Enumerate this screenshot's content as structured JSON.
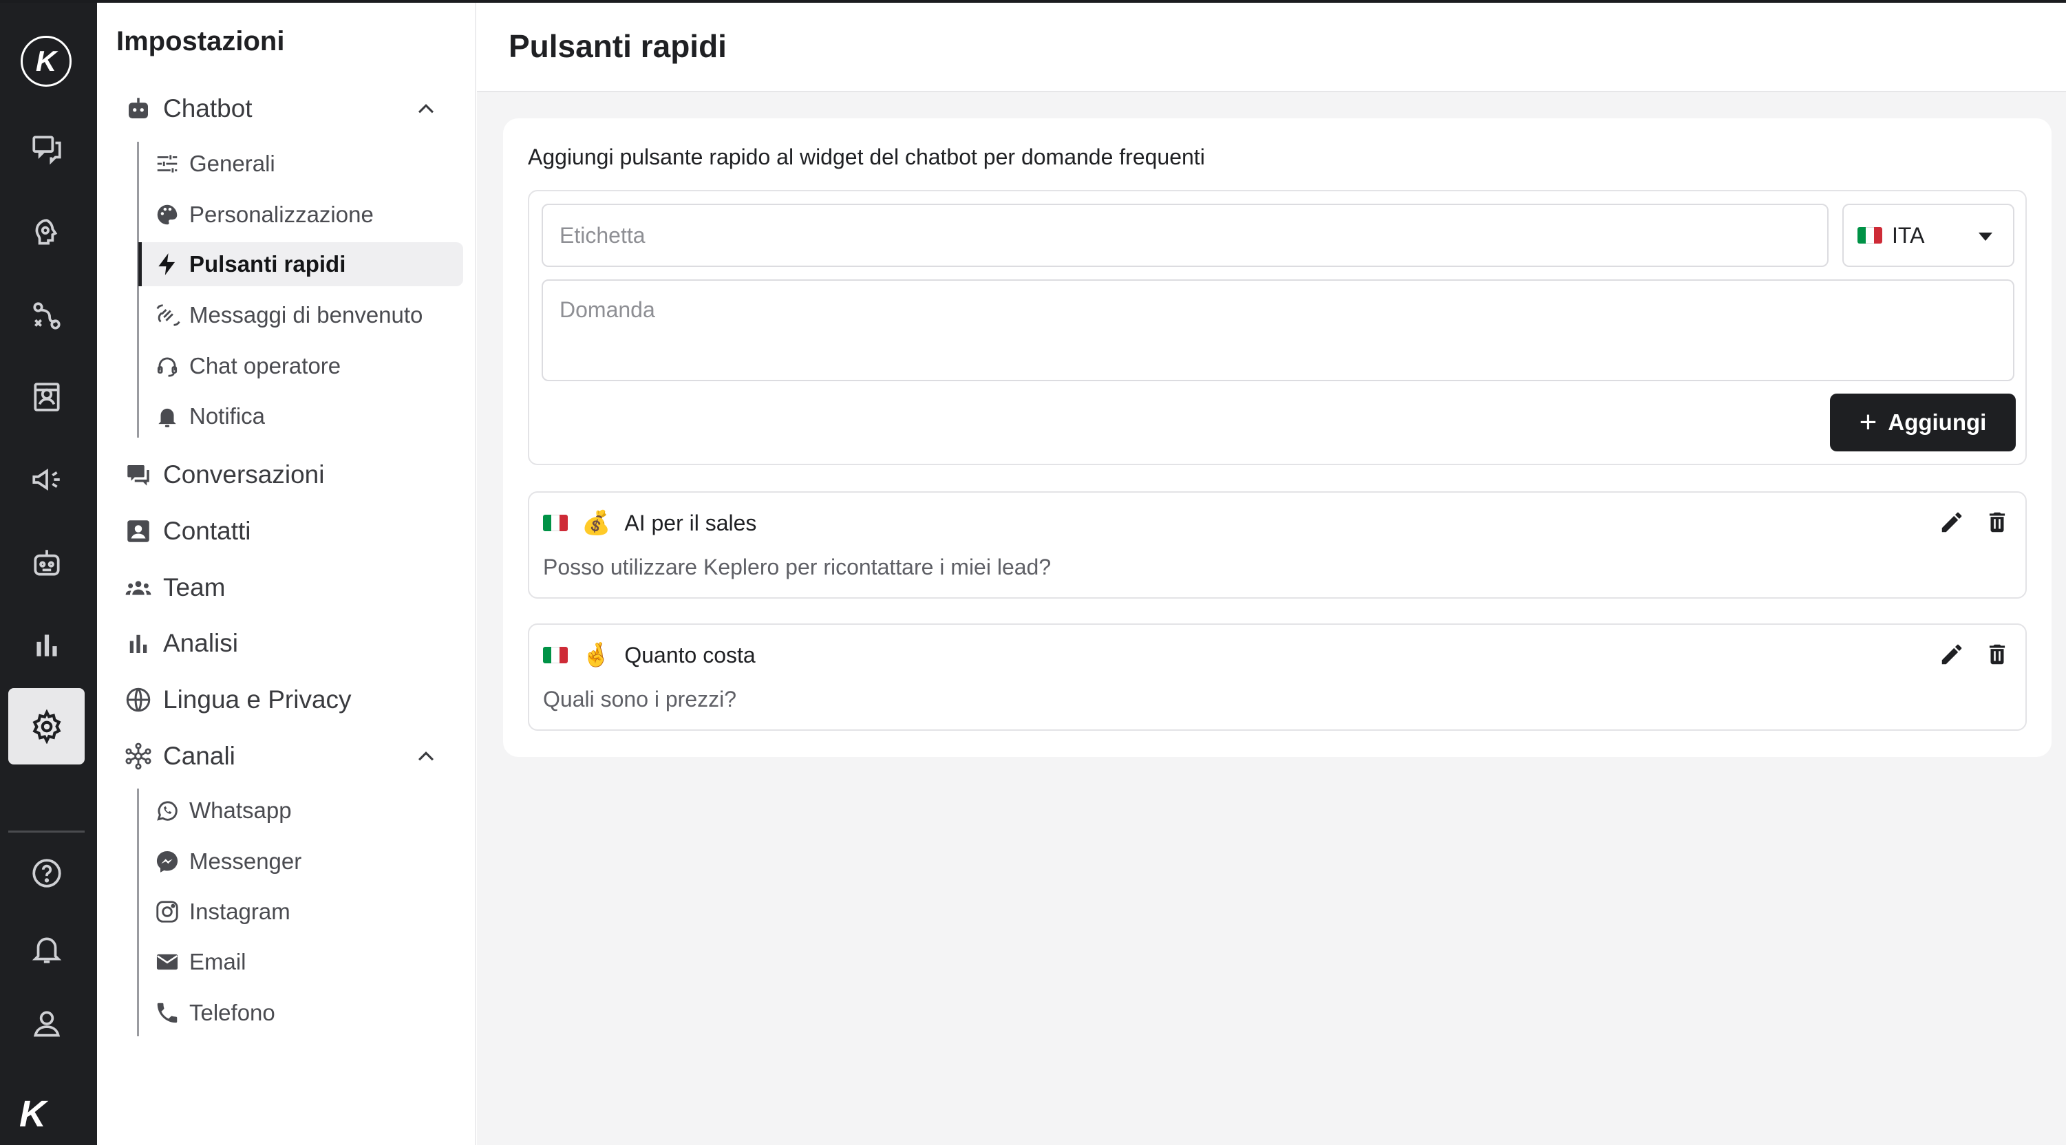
{
  "app": {
    "logo_letter": "K"
  },
  "rail": {
    "items": [
      {
        "name": "conversations-icon"
      },
      {
        "name": "knowledge-icon"
      },
      {
        "name": "flows-icon"
      },
      {
        "name": "contacts-icon"
      },
      {
        "name": "campaigns-icon"
      },
      {
        "name": "bot-icon"
      },
      {
        "name": "analytics-icon"
      },
      {
        "name": "settings-icon",
        "active": true
      }
    ],
    "bottom": [
      {
        "name": "help-icon"
      },
      {
        "name": "notifications-icon"
      },
      {
        "name": "profile-icon"
      }
    ]
  },
  "sidebar": {
    "title": "Impostazioni",
    "chatbot": {
      "label": "Chatbot",
      "items": [
        {
          "label": "Generali",
          "icon": "sliders-icon"
        },
        {
          "label": "Personalizzazione",
          "icon": "palette-icon"
        },
        {
          "label": "Pulsanti rapidi",
          "icon": "bolt-icon",
          "active": true
        },
        {
          "label": "Messaggi di benvenuto",
          "icon": "wave-icon"
        },
        {
          "label": "Chat operatore",
          "icon": "headset-icon"
        },
        {
          "label": "Notifica",
          "icon": "bell-icon"
        }
      ]
    },
    "sections": [
      {
        "label": "Conversazioni",
        "icon": "chat-icon"
      },
      {
        "label": "Contatti",
        "icon": "contact-card-icon"
      },
      {
        "label": "Team",
        "icon": "team-icon"
      },
      {
        "label": "Analisi",
        "icon": "bar-chart-icon"
      },
      {
        "label": "Lingua e Privacy",
        "icon": "globe-icon"
      }
    ],
    "canali": {
      "label": "Canali",
      "items": [
        {
          "label": "Whatsapp",
          "icon": "whatsapp-icon"
        },
        {
          "label": "Messenger",
          "icon": "messenger-icon"
        },
        {
          "label": "Instagram",
          "icon": "instagram-icon"
        },
        {
          "label": "Email",
          "icon": "email-icon"
        },
        {
          "label": "Telefono",
          "icon": "phone-icon"
        }
      ]
    }
  },
  "main": {
    "title": "Pulsanti rapidi",
    "description": "Aggiungi pulsante rapido al widget del chatbot per domande frequenti",
    "form": {
      "label_placeholder": "Etichetta",
      "question_placeholder": "Domanda",
      "language": "ITA",
      "add_label": "Aggiungi"
    },
    "quick_buttons": [
      {
        "emoji": "💰",
        "label": "AI per il sales",
        "question": "Posso utilizzare Keplero per ricontattare i miei lead?"
      },
      {
        "emoji": "🤞",
        "label": "Quanto costa",
        "question": "Quali sono i prezzi?"
      }
    ]
  },
  "colors": {
    "rail_bg": "#1e1f22",
    "primary_button": "#1e1f22",
    "content_bg": "#f4f4f5"
  }
}
